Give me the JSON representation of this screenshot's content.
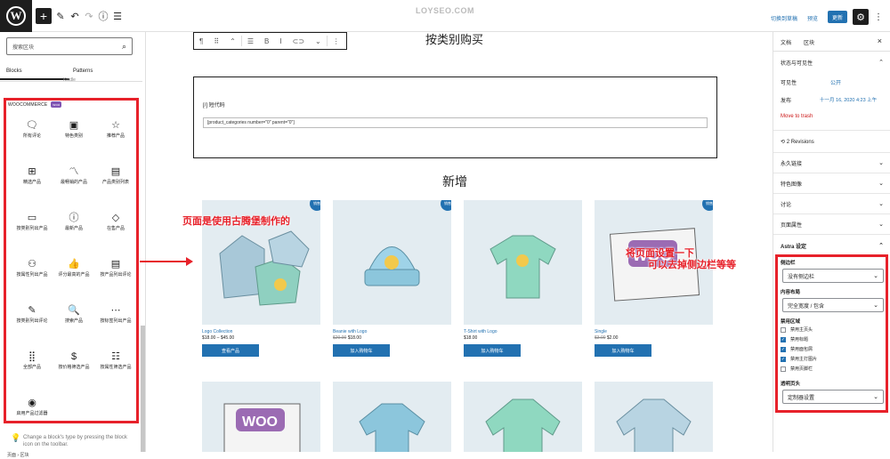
{
  "topbar": {
    "logo": "W",
    "plus": "+",
    "pen": "✎",
    "undo": "↶",
    "redo": "↷",
    "info": "ⓘ",
    "list": "☰",
    "watermark": "LOYSEO.COM",
    "switch_draft": "切换到草稿",
    "preview": "预览",
    "publish": "更新",
    "settings": "⚙",
    "more": "⋮"
  },
  "inserter": {
    "search_placeholder": "搜索区块",
    "tab_blocks": "Blocks",
    "tab_patterns": "Patterns",
    "kindle": "Kindle",
    "category": "WOOCOMMERCE",
    "badge": "woo",
    "blocks": [
      {
        "icon": "🗨",
        "label": "所有评论"
      },
      {
        "icon": "▣",
        "label": "特色类别"
      },
      {
        "icon": "☆",
        "label": "推荐产品"
      },
      {
        "icon": "⊞",
        "label": "精选产品"
      },
      {
        "icon": "〽",
        "label": "最畅销的产品"
      },
      {
        "icon": "▤",
        "label": "产品类别列表"
      },
      {
        "icon": "▭",
        "label": "按类别列出产品"
      },
      {
        "icon": "ⓘ",
        "label": "最新产品"
      },
      {
        "icon": "◇",
        "label": "在售产品"
      },
      {
        "icon": "⚇",
        "label": "按属性列出产品"
      },
      {
        "icon": "👍",
        "label": "评分最高的产品"
      },
      {
        "icon": "▤",
        "label": "按产品列出评论"
      },
      {
        "icon": "✎",
        "label": "按类别列出评论"
      },
      {
        "icon": "🔍",
        "label": "搜索产品"
      },
      {
        "icon": "⋯",
        "label": "按标签列出产品"
      },
      {
        "icon": "⣿",
        "label": "全部产品"
      },
      {
        "icon": "$",
        "label": "按价格筛选产品"
      },
      {
        "icon": "☷",
        "label": "按属性筛选产品"
      },
      {
        "icon": "◉",
        "label": "启用产品过滤器"
      }
    ],
    "hint": "Change a block's type by pressing the block icon on the toolbar."
  },
  "canvas": {
    "toolbar": [
      "¶",
      "⠿",
      "⌃",
      "☰",
      "B",
      "I",
      "⊂⊃",
      "⌄",
      "⋮"
    ],
    "heading_top": "按类别购买",
    "shortcode_label": "[/] 短代码",
    "shortcode_value": "[product_categories number=\"0\" parent=\"0\"]",
    "heading_new": "新增",
    "products": [
      {
        "name": "Logo Collection",
        "price": "$18.00 – $45.00",
        "old": "",
        "button": "查看产品",
        "sale": "销售"
      },
      {
        "name": "Beanie with Logo",
        "price": "$18.00",
        "old": "$20.00",
        "button": "加入购物车",
        "sale": "销售"
      },
      {
        "name": "T-Shirt with Logo",
        "price": "$18.00",
        "old": "",
        "button": "加入购物车",
        "sale": ""
      },
      {
        "name": "Single",
        "price": "$2.00",
        "old": "$3.00",
        "button": "加入购物车",
        "sale": "销售"
      }
    ],
    "ann_left": "页面是使用古腾堡制作的",
    "ann_right_1": "将页面设置一下",
    "ann_right_2": "可以去掉侧边栏等等"
  },
  "sidebar": {
    "tab_doc": "文档",
    "tab_block": "区块",
    "close": "×",
    "status": "状态与可见性",
    "visibility_label": "可见性",
    "visibility": "公开",
    "publish_label": "发布",
    "publish_date": "十一月 16, 2020 4:23 上午",
    "trash": "Move to trash",
    "revisions": "2 Revisions",
    "permalink": "永久链接",
    "featured": "特色图像",
    "discussion": "讨论",
    "page_attr": "页面属性",
    "astra": "Astra 设定",
    "sidebar_label": "侧边栏",
    "sidebar_value": "没有侧边栏",
    "layout_label": "内容布局",
    "layout_value": "完全宽度 / 包含",
    "disable_label": "禁用区域",
    "checks": [
      {
        "label": "禁用主页头",
        "on": false
      },
      {
        "label": "禁用标题",
        "on": true
      },
      {
        "label": "禁用面包屑",
        "on": true
      },
      {
        "label": "禁用主打图片",
        "on": true
      },
      {
        "label": "禁用页脚栏",
        "on": false
      }
    ],
    "transparent_label": "透明页头",
    "transparent_value": "定制器设置"
  },
  "status": "页面 › 区块"
}
